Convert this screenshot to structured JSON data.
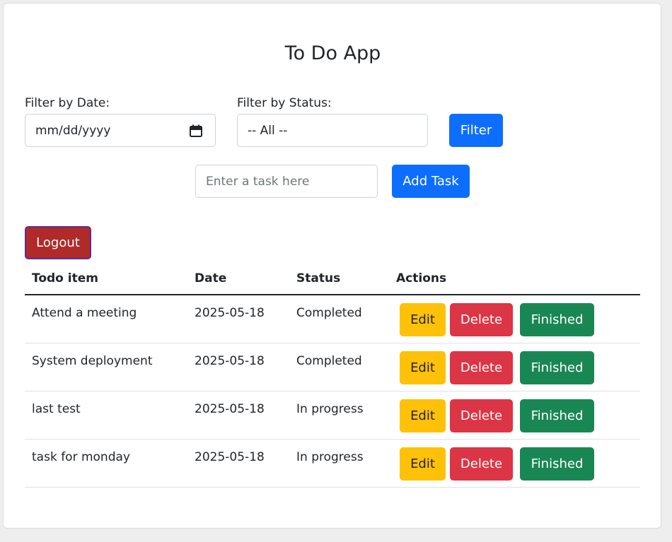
{
  "app": {
    "title": "To Do App"
  },
  "filters": {
    "date_label": "Filter by Date:",
    "date_placeholder": "mm/dd/yyyy",
    "status_label": "Filter by Status:",
    "status_value": "-- All --",
    "filter_button": "Filter"
  },
  "add_task": {
    "placeholder": "Enter a task here",
    "button": "Add Task"
  },
  "logout_button": "Logout",
  "table": {
    "headers": [
      "Todo item",
      "Date",
      "Status",
      "Actions"
    ],
    "rows": [
      {
        "item": "Attend a meeting",
        "date": "2025-05-18",
        "status": "Completed"
      },
      {
        "item": "System deployment",
        "date": "2025-05-18",
        "status": "Completed"
      },
      {
        "item": "last test",
        "date": "2025-05-18",
        "status": "In progress"
      },
      {
        "item": "task for monday",
        "date": "2025-05-18",
        "status": "In progress"
      }
    ],
    "actions": {
      "edit": "Edit",
      "delete": "Delete",
      "finish": "Finished"
    }
  },
  "colors": {
    "primary": "#0d6efd",
    "logout": "#b02a2a",
    "edit": "#ffc107",
    "delete": "#dc3545",
    "finish": "#198754"
  }
}
